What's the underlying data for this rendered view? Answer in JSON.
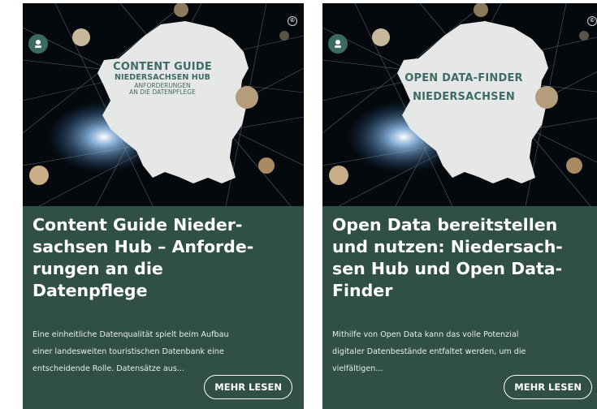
{
  "cards": [
    {
      "image": {
        "map_lines": [
          "CONTENT GUIDE",
          "NIEDERSACHSEN HUB",
          "ANFORDERUNGEN",
          "AN DIE DATENPFLEGE"
        ],
        "logo_icon": "hub-logo-icon",
        "copyright_mark": "©"
      },
      "title": "Content Guide Nieder-\nsachsen Hub – Anforde-\nrungen an die\nDatenpflege",
      "description": "Eine einheitliche Datenqualität spielt beim Aufbau\neiner landesweiten touristischen Datenbank eine\nentscheidende Rolle. Datensätze aus...",
      "button_label": "MEHR LESEN"
    },
    {
      "image": {
        "map_lines": [
          "OPEN DATA-FINDER",
          "NIEDERSACHSEN"
        ],
        "logo_icon": "hub-logo-icon",
        "copyright_mark": "©"
      },
      "title": "Open Data bereitstellen\nund nutzen: Niedersach-\nsen Hub und Open Data-\nFinder",
      "description": "Mithilfe von Open Data kann das volle Potenzial\ndigitaler Datenbestände entfaltet werden, um die\nvielfältigen...",
      "button_label": "MEHR LESEN"
    }
  ],
  "colors": {
    "card_background": "#2f4f47",
    "image_background": "#05080c",
    "map_fill": "#e6e8e8",
    "map_text": "#3f6b67",
    "button_border": "#ffffff"
  }
}
